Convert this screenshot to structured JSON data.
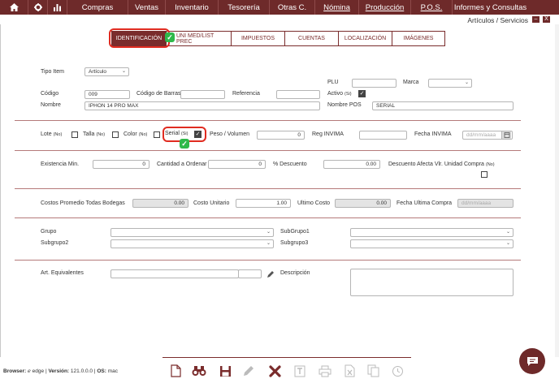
{
  "nav": {
    "icons": [
      "home-icon",
      "gear-icon",
      "bar-chart-icon"
    ],
    "menu": [
      "Compras",
      "Ventas",
      "Inventario",
      "Tesorería",
      "Otras C.",
      "Nómina",
      "Producción",
      "P.O.S.",
      "Informes y Consultas"
    ]
  },
  "window": {
    "title": "Artículos / Servicios",
    "minimize": "–",
    "close": "X"
  },
  "tabs": [
    "IDENTIFICACIÓN",
    "UNI MED/LIST PREC",
    "IMPUESTOS",
    "CUENTAS",
    "LOCALIZACIÓN",
    "IMÁGENES"
  ],
  "form": {
    "tipo_item": {
      "label": "Tipo Item",
      "value": "Artículo"
    },
    "plu": {
      "label": "PLU",
      "value": ""
    },
    "marca": {
      "label": "Marca",
      "value": ""
    },
    "codigo": {
      "label": "Código",
      "value": "009"
    },
    "codigo_barras": {
      "label": "Código de Barras",
      "value": ""
    },
    "referencia": {
      "label": "Referencia",
      "value": ""
    },
    "activo": {
      "label": "Activo",
      "tag": "(Si)",
      "checked": true
    },
    "nombre": {
      "label": "Nombre",
      "value": "IPHON 14 PRO MAX"
    },
    "nombre_pos": {
      "label": "Nombre POS",
      "value": "SERIAL"
    },
    "lote": {
      "label": "Lote",
      "tag": "(No)"
    },
    "talla": {
      "label": "Talla",
      "tag": "(No)"
    },
    "color": {
      "label": "Color",
      "tag": "(No)"
    },
    "serial": {
      "label": "Serial",
      "tag": "(Si)",
      "checked": true
    },
    "peso_volumen": {
      "label": "Peso / Volumen",
      "value": "0"
    },
    "reg_invima": {
      "label": "Reg INVIMA",
      "value": ""
    },
    "fecha_invima": {
      "label": "Fecha INVIMA",
      "placeholder": "dd/mm/aaaa"
    },
    "existencia_min": {
      "label": "Existencia Min.",
      "value": "0"
    },
    "cantidad_ordenar": {
      "label": "Cantidad a Ordenar",
      "value": "0"
    },
    "descuento": {
      "label": "% Descuento",
      "value": "0.00"
    },
    "descuento_afecta": {
      "label": "Descuento Afecta Vlr. Unidad Compra",
      "tag": "(No)"
    },
    "costos_promedio": {
      "label": "Costos Promedio Todas Bodegas",
      "value": "0.00"
    },
    "costo_unitario": {
      "label": "Costo Unitario",
      "value": "1.00"
    },
    "ultimo_costo": {
      "label": "Ultimo Costo",
      "value": "0.00"
    },
    "fecha_ultima_compra": {
      "label": "Fecha Ultima Compra",
      "placeholder": "dd/mm/aaaa"
    },
    "grupo": {
      "label": "Grupo",
      "value": ""
    },
    "subgrupo1": {
      "label": "SubGrupo1",
      "value": ""
    },
    "subgrupo2": {
      "label": "Subgrupo2",
      "value": ""
    },
    "subgrupo3": {
      "label": "Subgrupo3",
      "value": ""
    },
    "art_equivalentes": {
      "label": "Art. Equivalentes",
      "value": ""
    },
    "descripcion": {
      "label": "Descripción",
      "value": ""
    }
  },
  "footer": {
    "browser_label": "Browser:",
    "browser_value": "edge",
    "version_label": "Versión:",
    "version_value": "121.0.0.0",
    "os_label": "OS:",
    "os_value": "mac"
  },
  "toolbar": [
    "new-document-icon",
    "search-binoculars-icon",
    "save-icon",
    "edit-pencil-icon",
    "delete-x-icon",
    "text-icon",
    "print-icon",
    "excel-export-icon",
    "copy-icon",
    "history-icon"
  ],
  "colors": {
    "brand": "#6e2a2a",
    "highlight": "#e02b20",
    "check": "#2fb94a"
  }
}
